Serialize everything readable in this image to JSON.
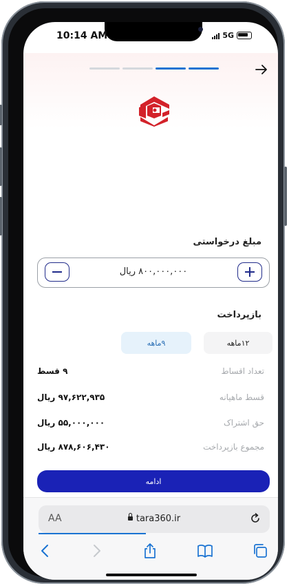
{
  "status": {
    "time": "10:14 AM",
    "network": "5G"
  },
  "progress": {
    "steps_total": 4,
    "steps_done": 2
  },
  "icons": {
    "back": "arrow-right-icon",
    "logo": "bank-logo",
    "minus": "minus-icon",
    "plus": "plus-icon",
    "lock": "lock-icon",
    "reload": "reload-icon",
    "nav_back": "chevron-left-icon",
    "nav_forward": "chevron-right-icon",
    "share": "share-icon",
    "bookmarks": "book-icon",
    "tabs": "tabs-icon"
  },
  "loan": {
    "amount_label": "مبلغ درخواستی",
    "amount_value": "۸۰۰,۰۰۰,۰۰۰ ریال"
  },
  "repayment": {
    "label": "بازپرداخت",
    "options": [
      {
        "label": "۱۲ماهه",
        "selected": false
      },
      {
        "label": "۹ماهه",
        "selected": true
      }
    ]
  },
  "details": [
    {
      "key": "تعداد اقساط",
      "value": "۹ قسط"
    },
    {
      "key": "قسط ماهیانه",
      "value": "۹۷,۶۲۲,۹۳۵ ریال"
    },
    {
      "key": "حق اشتراک",
      "value": "۵۵,۰۰۰,۰۰۰ ریال"
    },
    {
      "key": "مجموع بازپرداخت",
      "value": "۸۷۸,۶۰۶,۴۳۰ ریال"
    }
  ],
  "continue_label": "ادامه",
  "browser": {
    "aa_label": "AA",
    "url": "tara360.ir"
  },
  "colors": {
    "primary": "#1a22b6",
    "accent": "#1a73d2",
    "logo_red": "#d3222a",
    "selected_chip_bg": "#e6f2fb"
  }
}
